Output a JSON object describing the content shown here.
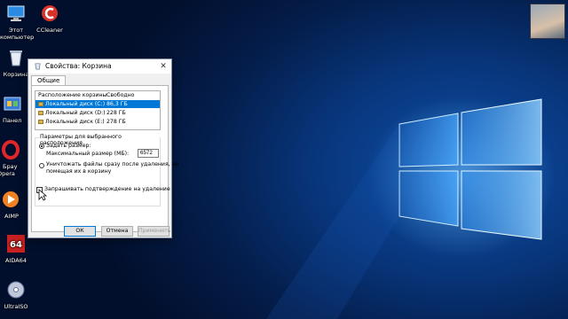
{
  "desktop": {
    "icons": [
      {
        "label": "Этот компьютер",
        "icon": "computer-icon"
      },
      {
        "label": "CCleaner",
        "icon": "ccleaner-icon"
      },
      {
        "label": "Корзина",
        "icon": "recycle-bin-icon"
      },
      {
        "label": "Панел",
        "icon": "control-panel-icon"
      },
      {
        "label": "Брау Opera",
        "icon": "opera-icon"
      },
      {
        "label": "AIMP",
        "icon": "aimp-icon"
      },
      {
        "label": "AIDA64",
        "icon": "aida64-icon"
      },
      {
        "label": "UltraISO",
        "icon": "ultraiso-icon"
      }
    ]
  },
  "dialog": {
    "title": "Свойства: Корзина",
    "close_glyph": "✕",
    "tab_label": "Общие",
    "list": {
      "col_location": "Расположение корзины",
      "col_free": "Свободно",
      "rows": [
        {
          "name": "Локальный диск (C:)",
          "free": "86,3 ГБ",
          "selected": true
        },
        {
          "name": "Локальный диск (D:)",
          "free": "228 ГБ",
          "selected": false
        },
        {
          "name": "Локальный диск (E:)",
          "free": "278 ГБ",
          "selected": false
        }
      ]
    },
    "group": {
      "title": "Параметры для выбранного расположения",
      "option_custom": "Задать размер:",
      "max_size_label": "Максимальный размер (МБ):",
      "max_size_value": "6572",
      "option_delete_line1": "Уничтожать файлы сразу после удаления, не",
      "option_delete_line2": "помещая их в корзину"
    },
    "confirm_delete_label": "Запрашивать подтверждение на удаление",
    "buttons": {
      "ok": "ОК",
      "cancel": "Отмена",
      "apply": "Применить"
    }
  }
}
